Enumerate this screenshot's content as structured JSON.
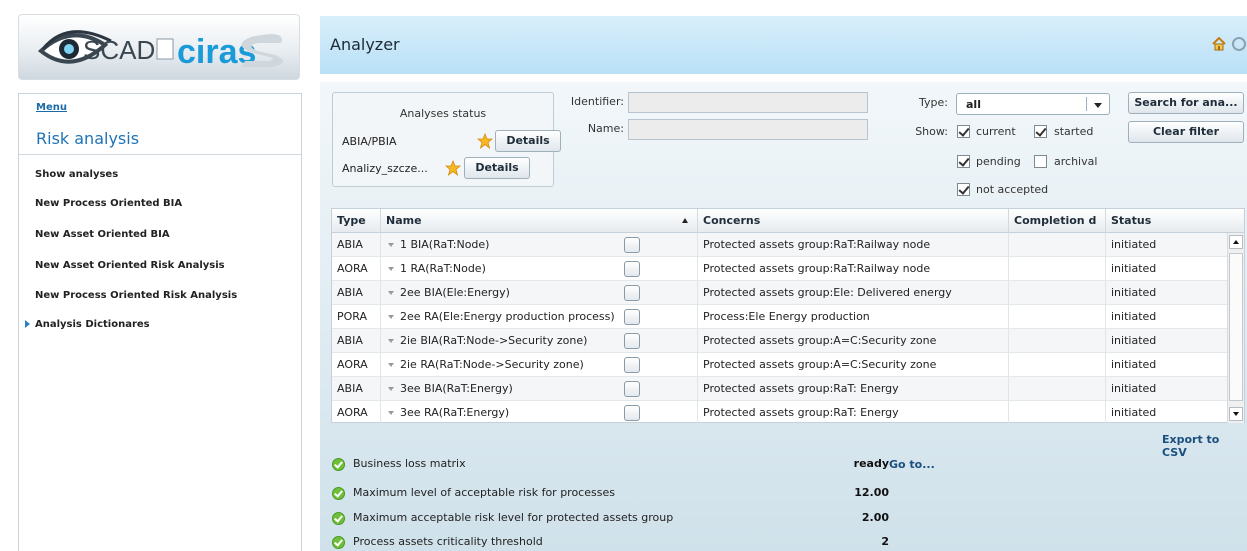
{
  "logo": {
    "text_scad": "SCAD",
    "text_ciras": "ciras"
  },
  "sidebar": {
    "menu_label": "Menu",
    "title": "Risk analysis",
    "items": [
      {
        "label": "Show analyses"
      },
      {
        "label": "New Process Oriented BIA"
      },
      {
        "label": "New Asset Oriented BIA"
      },
      {
        "label": "New Asset Oriented Risk Analysis"
      },
      {
        "label": "New Process Oriented Risk Analysis"
      },
      {
        "label": "Analysis Dictionares"
      }
    ]
  },
  "header": {
    "title": "Analyzer",
    "home_icon": "home-icon",
    "help_icon": "help-icon"
  },
  "status_box": {
    "title": "Analyses status",
    "rows": [
      {
        "label": "ABIA/PBIA",
        "button": "Details"
      },
      {
        "label": "Analizy_szcze...",
        "button": "Details"
      }
    ]
  },
  "filters": {
    "identifier_label": "Identifier:",
    "identifier_value": "",
    "name_label": "Name:",
    "name_value": "",
    "type_label": "Type:",
    "type_value": "all",
    "show_label": "Show:",
    "checkboxes": [
      {
        "label": "current",
        "checked": true
      },
      {
        "label": "started",
        "checked": true
      },
      {
        "label": "pending",
        "checked": true
      },
      {
        "label": "archival",
        "checked": false
      },
      {
        "label": "not accepted",
        "checked": true
      }
    ],
    "search_button": "Search for ana...",
    "clear_button": "Clear filter"
  },
  "table": {
    "columns": [
      "Type",
      "Name",
      "Concerns",
      "Completion d",
      "Status"
    ],
    "rows": [
      {
        "type": "ABIA",
        "name": "1 BIA(RaT:Node)",
        "concerns": "Protected assets group:RaT:Railway node",
        "completion": "",
        "status": "initiated"
      },
      {
        "type": "AORA",
        "name": "1 RA(RaT:Node)",
        "concerns": "Protected assets group:RaT:Railway node",
        "completion": "",
        "status": "initiated"
      },
      {
        "type": "ABIA",
        "name": "2ee BIA(Ele:Energy)",
        "concerns": "Protected assets group:Ele: Delivered energy",
        "completion": "",
        "status": "initiated"
      },
      {
        "type": "PORA",
        "name": "2ee RA(Ele:Energy production process)",
        "concerns": "Process:Ele Energy production",
        "completion": "",
        "status": "initiated"
      },
      {
        "type": "ABIA",
        "name": "2ie BIA(RaT:Node->Security zone)",
        "concerns": "Protected assets group:A=C:Security zone",
        "completion": "",
        "status": "initiated"
      },
      {
        "type": "AORA",
        "name": "2ie RA(RaT:Node->Security zone)",
        "concerns": "Protected assets group:A=C:Security zone",
        "completion": "",
        "status": "initiated"
      },
      {
        "type": "ABIA",
        "name": "3ee BIA(RaT:Energy)",
        "concerns": "Protected assets group:RaT: Energy",
        "completion": "",
        "status": "initiated"
      },
      {
        "type": "AORA",
        "name": "3ee RA(RaT:Energy)",
        "concerns": "Protected assets group:RaT: Energy",
        "completion": "",
        "status": "initiated"
      }
    ],
    "export_label": "Export to CSV"
  },
  "checks": [
    {
      "label": "Business loss matrix",
      "value": "ready"
    },
    {
      "label": "Maximum level of acceptable risk for processes",
      "value": "12.00"
    },
    {
      "label": "Maximum acceptable risk level for protected assets group",
      "value": "2.00"
    },
    {
      "label": "Process assets criticality threshold",
      "value": "2"
    }
  ],
  "goto_label": "Go to..."
}
